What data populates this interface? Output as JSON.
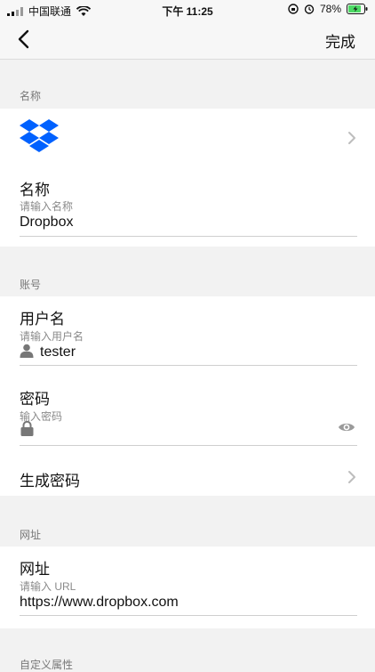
{
  "status_bar": {
    "carrier": "中国联通",
    "time": "下午 11:25",
    "battery": "78%"
  },
  "nav": {
    "done_label": "完成"
  },
  "sections": {
    "name_header": "名称",
    "account_header": "账号",
    "url_header": "网址",
    "custom_header": "自定义属性"
  },
  "name_card": {
    "icon": "dropbox-icon",
    "title": "名称",
    "hint": "请输入名称",
    "value": "Dropbox"
  },
  "account_card": {
    "username_title": "用户名",
    "username_hint": "请输入用户名",
    "username_value": "tester",
    "password_title": "密码",
    "password_hint": "输入密码",
    "password_value": "",
    "generate_label": "生成密码"
  },
  "url_card": {
    "title": "网址",
    "hint": "请输入 URL",
    "value": "https://www.dropbox.com"
  },
  "colors": {
    "dropbox_blue": "#0061ff",
    "background": "#f2f2f2"
  }
}
